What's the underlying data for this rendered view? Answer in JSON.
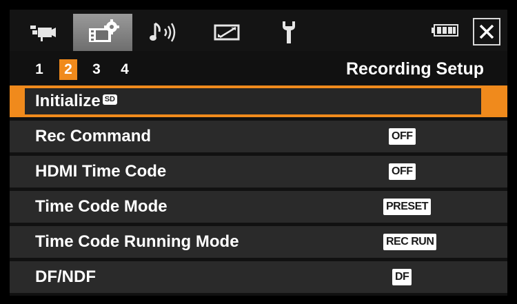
{
  "tabs": [
    {
      "icon": "video-camera-icon",
      "active": false
    },
    {
      "icon": "camera-settings-icon",
      "active": true
    },
    {
      "icon": "audio-note-icon",
      "active": false
    },
    {
      "icon": "display-icon",
      "active": false
    },
    {
      "icon": "wrench-icon",
      "active": false
    }
  ],
  "status": {
    "battery_icon": "battery-icon",
    "close_icon": "close-icon"
  },
  "pages": {
    "numbers": [
      "1",
      "2",
      "3",
      "4"
    ],
    "active_index": 1,
    "title": "Recording Setup"
  },
  "menu": {
    "items": [
      {
        "label": "Initialize",
        "badge": "SD",
        "value": ""
      },
      {
        "label": "Rec Command",
        "value": "OFF"
      },
      {
        "label": "HDMI Time Code",
        "value": "OFF"
      },
      {
        "label": "Time Code Mode",
        "value": "PRESET"
      },
      {
        "label": "Time Code Running Mode",
        "value": "REC RUN"
      },
      {
        "label": "DF/NDF",
        "value": "DF"
      }
    ],
    "selected_index": 0
  },
  "colors": {
    "accent": "#f08a1c",
    "row_bg": "#2a2a2a",
    "active_tab": "#8a8a8a"
  }
}
